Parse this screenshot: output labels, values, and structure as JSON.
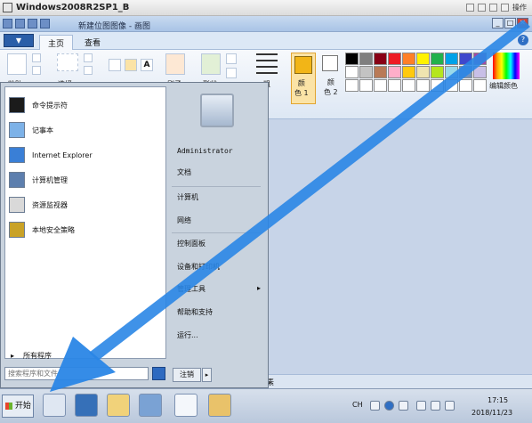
{
  "host": {
    "title": "Windows2008R2SP1_B",
    "tools_label": "操作"
  },
  "paint": {
    "title": "新建位图图像 - 画图",
    "menu_label": "▼",
    "tabs": [
      {
        "label": "主页"
      },
      {
        "label": "查看"
      }
    ],
    "help": "?",
    "ribbon": {
      "paste_label": "粘贴",
      "select_label": "选择",
      "brushes_label": "刷子",
      "shapes_label": "形状",
      "outline_label": "粗",
      "color1_label": "颜\n色 1",
      "color2_label": "颜\n色 2",
      "edit_colors_label": "编辑颜色"
    },
    "status_text": "素",
    "palette_colors": [
      "#000000",
      "#7f7f7f",
      "#880015",
      "#ed1c24",
      "#ff7f27",
      "#fff200",
      "#22b14c",
      "#00a2e8",
      "#3f48cc",
      "#a349a4",
      "#ffffff",
      "#c3c3c3",
      "#b97a57",
      "#ffaec9",
      "#ffc90e",
      "#efe4b0",
      "#b5e61d",
      "#99d9ea",
      "#7092be",
      "#c8bfe7",
      "#ffffff",
      "#ffffff",
      "#ffffff",
      "#ffffff",
      "#ffffff",
      "#ffffff",
      "#ffffff",
      "#ffffff",
      "#ffffff",
      "#ffffff"
    ],
    "color1": "#f2b517",
    "color2": "#ffffff"
  },
  "start_menu": {
    "programs": [
      {
        "label": "命令提示符",
        "icon": "cmd-icon",
        "color": "#1b1b1b"
      },
      {
        "label": "记事本",
        "icon": "notepad-icon",
        "color": "#7db2e8"
      },
      {
        "label": "Internet Explorer",
        "icon": "ie-icon",
        "color": "#3a7fd6"
      },
      {
        "label": "计算机管理",
        "icon": "computer-management-icon",
        "color": "#5d7fae"
      },
      {
        "label": "资源监视器",
        "icon": "resource-monitor-icon",
        "color": "#d9d9d9"
      },
      {
        "label": "本地安全策略",
        "icon": "security-policy-icon",
        "color": "#c9a227"
      }
    ],
    "all_programs": "所有程序",
    "search_placeholder": "搜索程序和文件",
    "right_items": [
      "Administrator",
      "文档",
      "计算机",
      "网络",
      "控制面板",
      "设备和打印机",
      "管理工具",
      "帮助和支持",
      "运行..."
    ],
    "shutdown_label": "注销",
    "shutdown_arrow": "▸"
  },
  "taskbar": {
    "start_label": "开始",
    "ime": "CH",
    "time": "17:15",
    "date": "2018/11/23"
  }
}
